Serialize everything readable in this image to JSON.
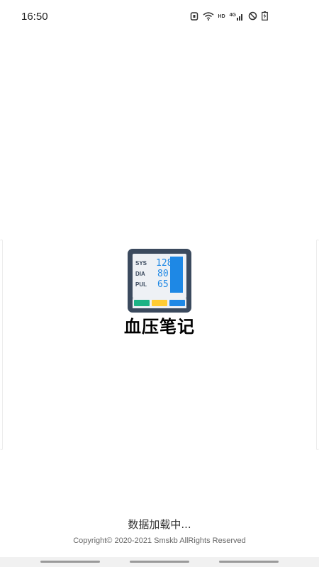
{
  "status_bar": {
    "time": "16:50",
    "network_label": "HD",
    "signal_label": "4G",
    "icons": [
      "alarm-icon",
      "wifi-icon",
      "hd-icon",
      "signal-icon",
      "do-not-disturb-icon",
      "battery-icon"
    ]
  },
  "splash": {
    "logo_icon": "blood-pressure-monitor-icon",
    "monitor_labels": [
      "SYS",
      "DIA",
      "PUL"
    ],
    "monitor_values": [
      "128",
      "80",
      "65"
    ],
    "title": "血压笔记"
  },
  "footer": {
    "loading": "数据加载中...",
    "copyright": "Copyright© 2020-2021 Smskb AllRights Reserved"
  },
  "colors": {
    "background": "#ffffff",
    "monitor_body": "#3b4a5e",
    "monitor_screen": "#1e88e5",
    "button_green": "#1db385",
    "button_yellow": "#ffcc33",
    "button_blue": "#1e88e5"
  }
}
